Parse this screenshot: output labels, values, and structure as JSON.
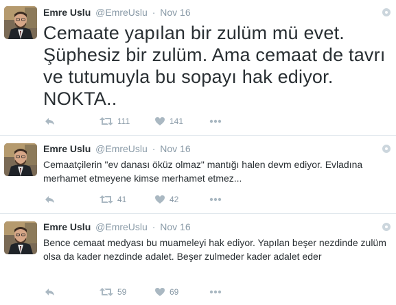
{
  "colors": {
    "icon": "#aab8c2",
    "meta": "#8899a6",
    "text": "#292f33",
    "divider": "#e1e8ed"
  },
  "tweets": [
    {
      "name": "Emre Uslu",
      "handle": "@EmreUslu",
      "separator": "·",
      "time": "Nov 16",
      "text": "Cemaate yapılan bir zulüm mü evet. Şüphesiz bir zulüm. Ama cemaat de tavrı ve tutumuyla bu sopayı hak ediyor. NOKTA..",
      "retweets": "111",
      "likes": "141"
    },
    {
      "name": "Emre Uslu",
      "handle": "@EmreUslu",
      "separator": "·",
      "time": "Nov 16",
      "text": "Cemaatçilerin \"ev danası öküz olmaz\" mantığı halen devm ediyor. Evladına merhamet etmeyene kimse merhamet etmez...",
      "retweets": "41",
      "likes": "42"
    },
    {
      "name": "Emre Uslu",
      "handle": "@EmreUslu",
      "separator": "·",
      "time": "Nov 16",
      "text": "Bence cemaat medyası bu muameleyi hak ediyor. Yapılan beşer nezdinde zulüm olsa da kader nezdinde adalet. Beşer zulmeder kader adalet eder",
      "retweets": "59",
      "likes": "69"
    }
  ]
}
